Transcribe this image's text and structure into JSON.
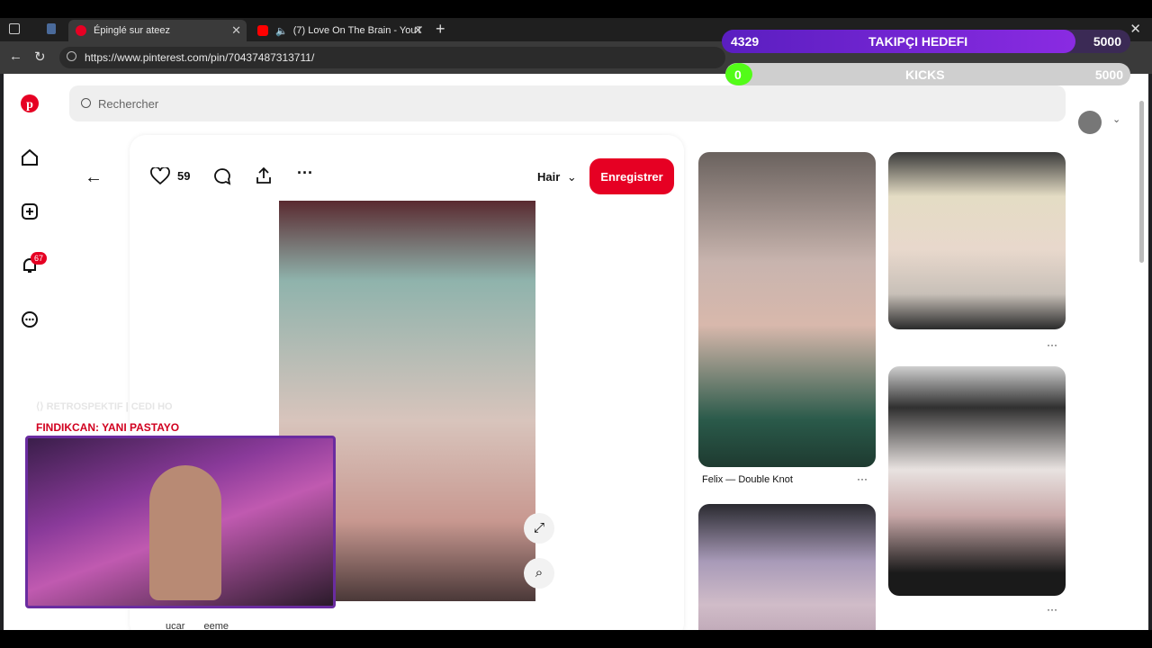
{
  "tabs": [
    {
      "label": "Épinglé sur ateez"
    },
    {
      "label": "(7) Love On The Brain - YouT"
    }
  ],
  "address": {
    "url": "https://www.pinterest.com/pin/70437487313711/"
  },
  "search": {
    "placeholder": "Rechercher"
  },
  "pin": {
    "like_count": "59",
    "board_label": "Hair",
    "save_label": "Enregistrer",
    "author_fragment": "ucar",
    "author_tail": "eeme"
  },
  "sidebar": {
    "notification_badge": "67"
  },
  "grid": {
    "caption_1": "Felix — Double Knot",
    "more_label": "···"
  },
  "stream_overlay": {
    "goal_title": "TAKIPÇI HEDEFI",
    "goal_current": "4329",
    "goal_target": "5000",
    "goal_progress": 0.8658,
    "kicks_title": "KICKS",
    "kicks_current": "0",
    "kicks_target": "5000",
    "kicks_progress": 0.0,
    "chat_line_faded": "⟨⟩ RETROSPEKTIF | CEDI HO",
    "chat_line": "FINDIKCAN: YANI PASTAYO"
  },
  "colors": {
    "pinterest_red": "#e60023",
    "goal_purple": "#6a1fd1",
    "kicks_green": "#53fc18"
  }
}
